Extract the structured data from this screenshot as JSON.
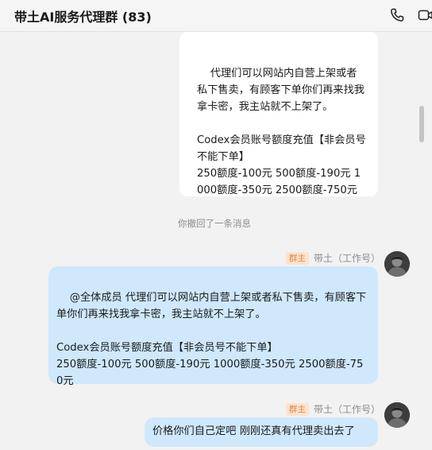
{
  "header": {
    "title": "带土AI服务代理群 (83)",
    "icons": [
      "phone-icon",
      "video-call-icon"
    ]
  },
  "messages": {
    "top_message": {
      "text": "代理们可以网站内自营上架或者私下售卖，有顾客下单你们再来找我拿卡密，我主站就不上架了。\n\nCodex会员账号额度充值【非会员号不能下单】\n250额度-100元 500额度-190元 1000额度-350元 2500额度-750元"
    },
    "recall_notice": "你撤回了一条消息",
    "message_2": {
      "sender_name": "带土（工作号）",
      "role_badge": "群主",
      "text": "@全体成员 代理们可以网站内自营上架或者私下售卖，有顾客下单你们再来找我拿卡密，我主站就不上架了。\n\nCodex会员账号额度充值【非会员号不能下单】\n250额度-100元 500额度-190元 1000额度-350元 2500额度-750元"
    },
    "message_3": {
      "sender_name": "带土（工作号）",
      "role_badge": "群主",
      "text": "价格你们自己定吧 刚刚还真有代理卖出去了"
    }
  },
  "colors": {
    "self_bubble": "#cfe8fc",
    "other_bubble": "#ffffff",
    "badge_text": "#e8833a",
    "badge_bg": "#fde3cf"
  }
}
